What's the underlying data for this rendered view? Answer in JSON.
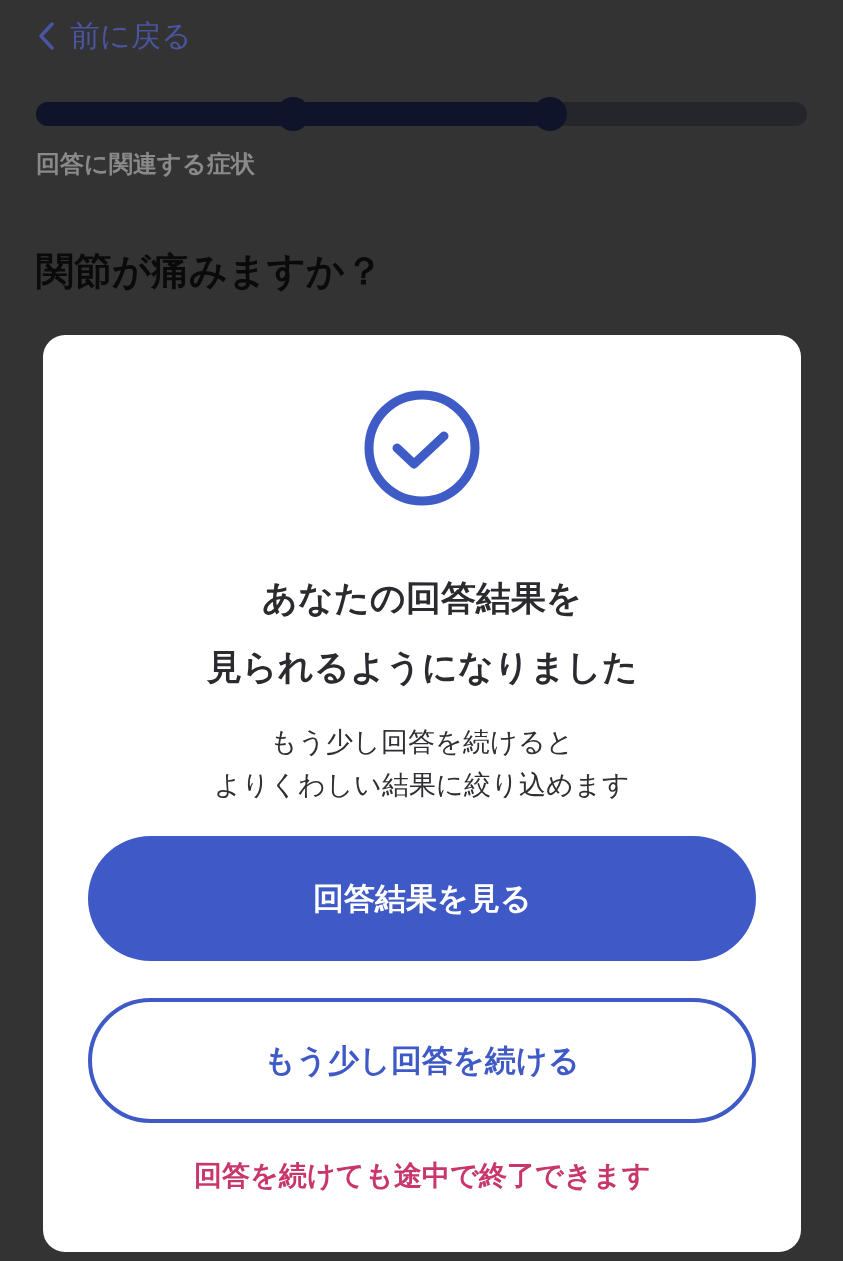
{
  "back_link": {
    "label": "前に戻る"
  },
  "progress": {
    "level": 0.66,
    "markers": [
      {
        "reached": true
      },
      {
        "reached": true
      }
    ]
  },
  "section_label": "回答に関連する症状",
  "question": "関節が痛みますか？",
  "dialog": {
    "title_lines": [
      "あなたの回答結果を",
      "見られるようになりました"
    ],
    "message_lines": [
      "もう少し回答を続けると",
      "よりくわしい結果に絞り込めます"
    ],
    "buttons": [
      {
        "label": "回答結果を見る",
        "kind": "primary"
      },
      {
        "label": "もう少し回答を続ける",
        "kind": "secondary"
      }
    ],
    "note": "回答を続けても途中で終了できます"
  }
}
